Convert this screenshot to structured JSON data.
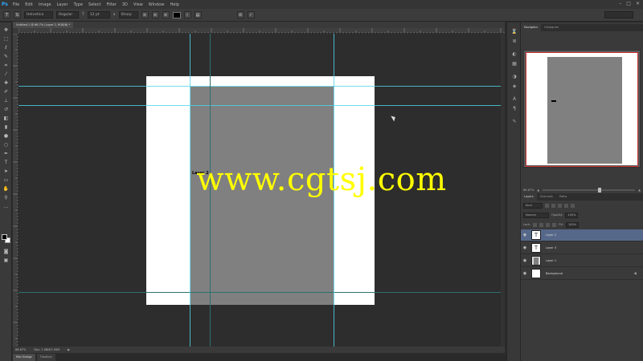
{
  "app": {
    "logo": "Ps"
  },
  "menu": {
    "items": [
      "File",
      "Edit",
      "Image",
      "Layer",
      "Type",
      "Select",
      "Filter",
      "3D",
      "View",
      "Window",
      "Help"
    ]
  },
  "window_controls": {
    "minimize": "–",
    "maximize": "□",
    "close": "✕"
  },
  "options": {
    "font_family": "Helvetica",
    "font_style": "Regular",
    "font_size": "12 pt",
    "antialias": "Sharp",
    "color": "#000000"
  },
  "document": {
    "tab_title": "Untitled-1 @ 66.7% (Layer 2, RGB/8) *",
    "zoom": "66.67%",
    "doc_info": "Doc: 1.58M/1.05M"
  },
  "canvas": {
    "layer_text": "Layer 2"
  },
  "watermark": "www.cgtsj.com",
  "bottom_tabs": [
    "Mini Bridge",
    "Timeline"
  ],
  "panels": {
    "top_tabs": [
      "Navigator",
      "Histogram"
    ],
    "nav_zoom": "66.67%",
    "layers_tabs": [
      "Layers",
      "Channels",
      "Paths"
    ],
    "kind_filter": "Kind",
    "blend_mode": "Normal",
    "opacity_label": "Opacity:",
    "opacity_value": "100%",
    "lock_label": "Lock:",
    "fill_label": "Fill:",
    "fill_value": "100%",
    "layers": [
      {
        "name": "Layer 2",
        "type": "text",
        "selected": true
      },
      {
        "name": "Layer 3",
        "type": "text",
        "selected": false
      },
      {
        "name": "Layer 1",
        "type": "gray",
        "selected": false
      },
      {
        "name": "Background",
        "type": "white",
        "selected": false
      }
    ]
  },
  "colors": {
    "guide": "#4fd6e8",
    "selected_layer": "#56688a",
    "watermark": "#ffff00"
  }
}
